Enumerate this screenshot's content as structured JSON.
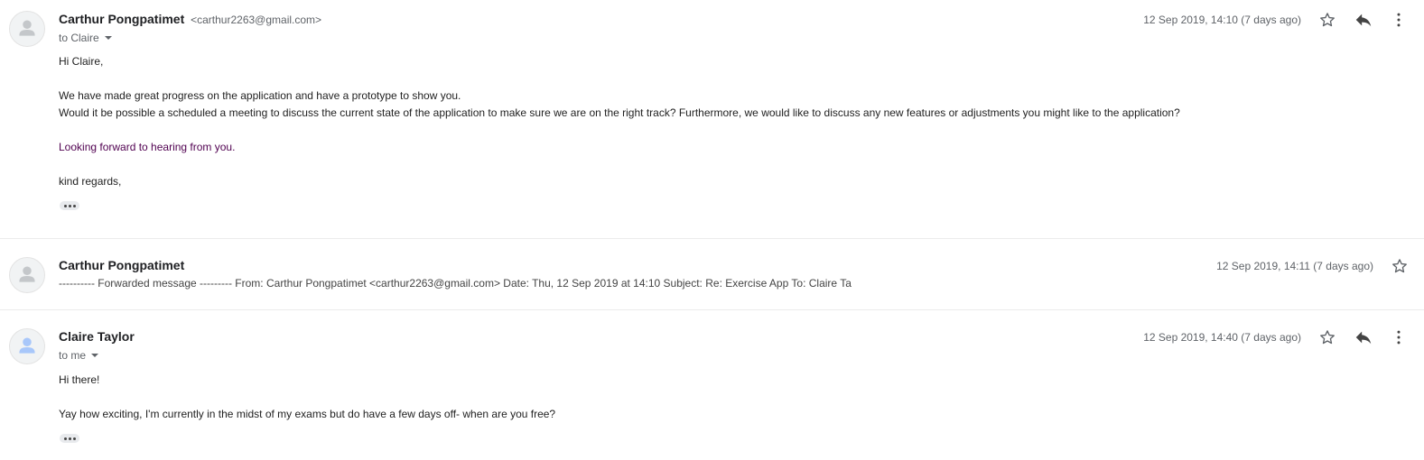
{
  "messages": [
    {
      "sender_name": "Carthur Pongpatimet",
      "sender_email": "<carthur2263@gmail.com>",
      "to_label": "to Claire",
      "timestamp": "12 Sep 2019, 14:10 (7 days ago)",
      "body": {
        "greeting": "Hi Claire,",
        "line1": "We have made great progress on the application and have a prototype to show you.",
        "line2": "Would it be possible a scheduled a meeting to discuss the current state of the application to make sure we are on the right track? Furthermore, we would like to discuss any new features or adjustments you might like to the application?",
        "line3": "Looking forward to hearing from you.",
        "signoff": "kind regards,"
      },
      "avatar_color": "#c4c7ca",
      "icons": [
        "star-icon",
        "reply-icon",
        "more-vert-icon"
      ]
    },
    {
      "sender_name": "Carthur Pongpatimet",
      "timestamp": "12 Sep 2019, 14:11 (7 days ago)",
      "snippet": "---------- Forwarded message --------- From: Carthur Pongpatimet <carthur2263@gmail.com> Date: Thu, 12 Sep 2019 at 14:10 Subject: Re: Exercise App To: Claire Ta",
      "avatar_color": "#c4c7ca",
      "icons": [
        "star-icon"
      ]
    },
    {
      "sender_name": "Claire Taylor",
      "to_label": "to me",
      "timestamp": "12 Sep 2019, 14:40 (7 days ago)",
      "body": {
        "greeting": "Hi there!",
        "line1": "Yay how exciting, I'm currently in the midst of my exams but do have a few days off- when are you free?"
      },
      "avatar_color": "#a8c7fa",
      "icons": [
        "star-icon",
        "reply-icon",
        "more-vert-icon"
      ]
    }
  ],
  "colors": {
    "purple_text": "#500050",
    "meta_text": "#5f6368"
  }
}
